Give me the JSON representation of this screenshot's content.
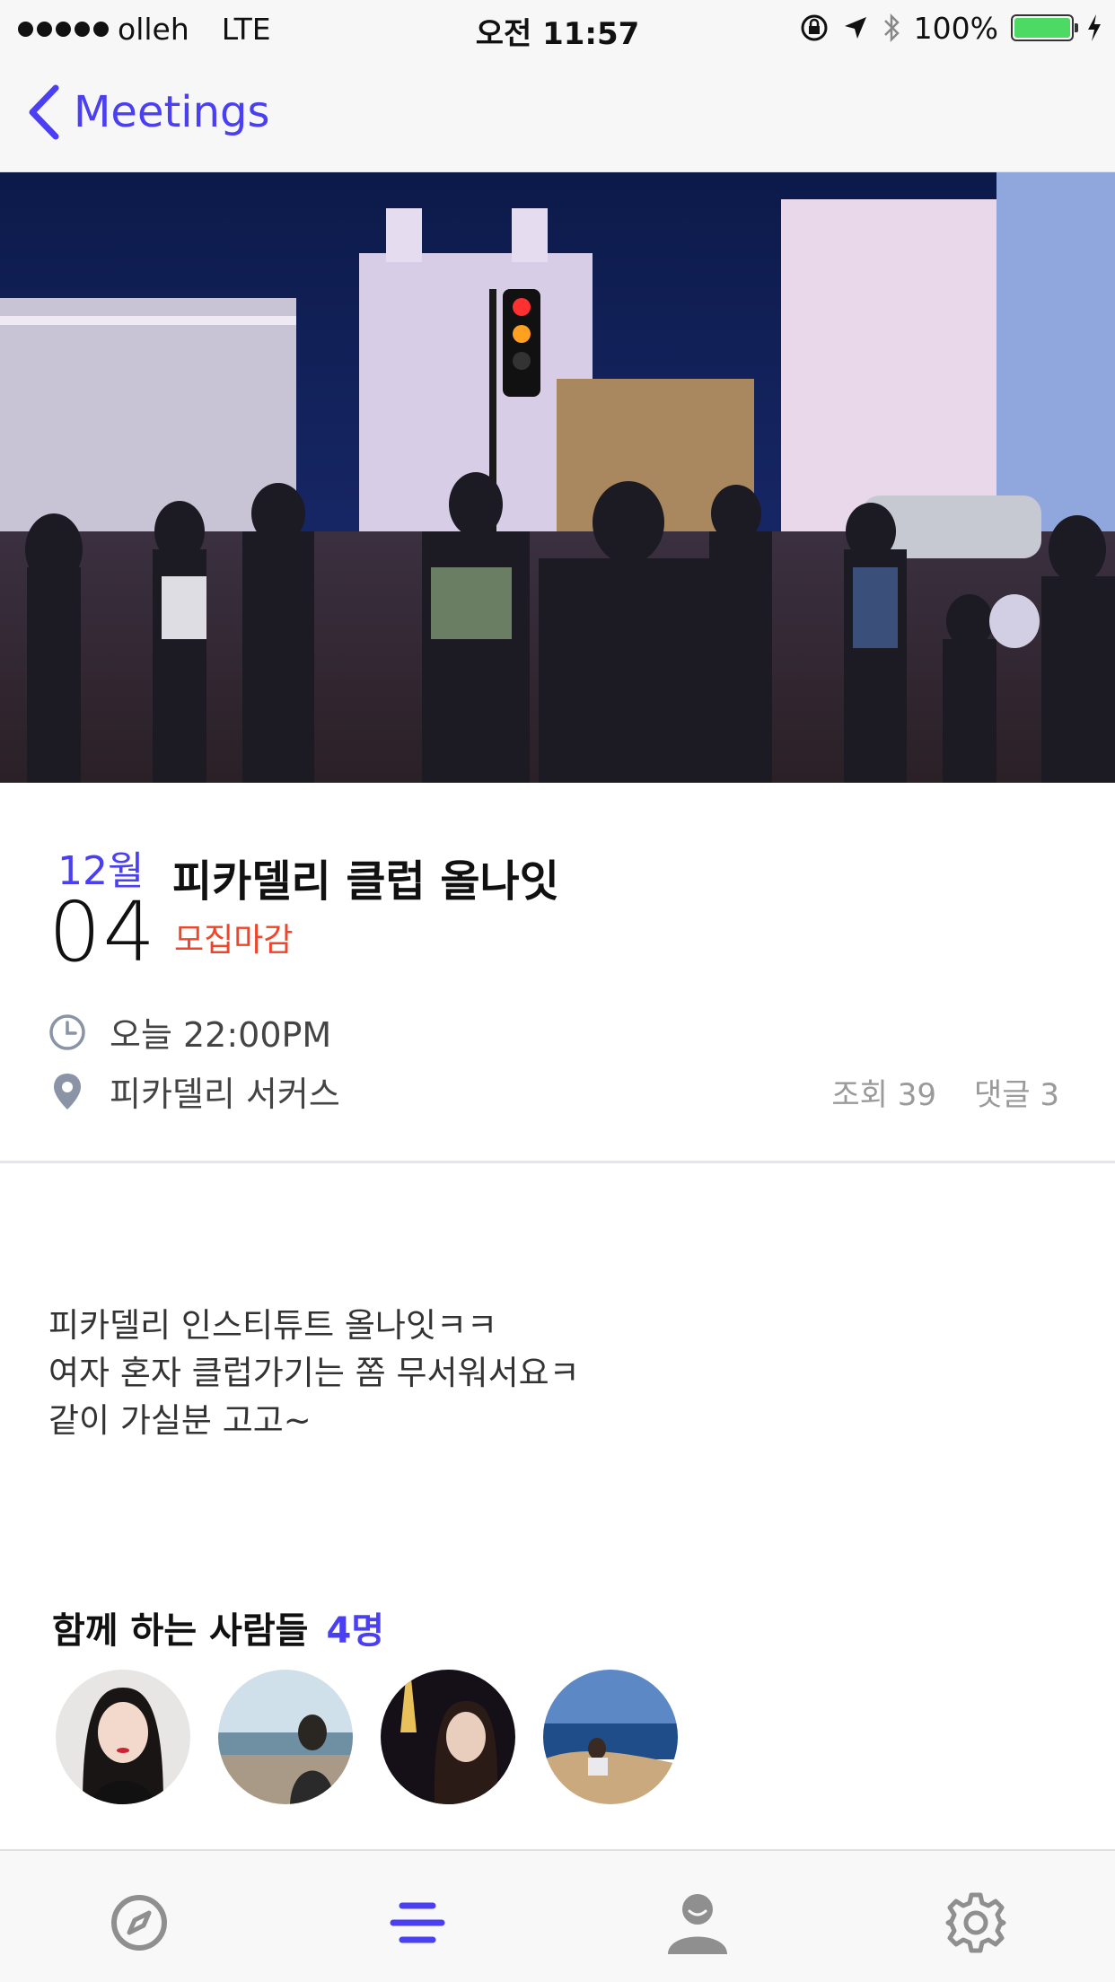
{
  "status_bar": {
    "carrier": "olleh",
    "network": "LTE",
    "time": "오전 11:57",
    "battery": "100%",
    "battery_level": 1.0
  },
  "nav": {
    "back_label": "Meetings"
  },
  "meeting": {
    "month": "12월",
    "day": "04",
    "title": "피카델리 클럽 올나잇",
    "status": "모집마감",
    "time": "오늘 22:00PM",
    "place": "피카델리 서커스",
    "views": "조회 39",
    "comments": "댓글 3",
    "description": [
      "피카델리 인스티튜트 올나잇ㅋㅋ",
      "여자 혼자 클럽가기는 쫌 무서워서요ㅋ",
      "같이 가실분 고고~"
    ]
  },
  "participants": {
    "title": "함께 하는 사람들",
    "count": "4명"
  },
  "tabs": [
    {
      "icon": "compass-icon"
    },
    {
      "icon": "list-icon",
      "active": true
    },
    {
      "icon": "person-icon"
    },
    {
      "icon": "gear-icon"
    }
  ],
  "colors": {
    "accent": "#4a3ff2",
    "status_red": "#f0452b"
  }
}
